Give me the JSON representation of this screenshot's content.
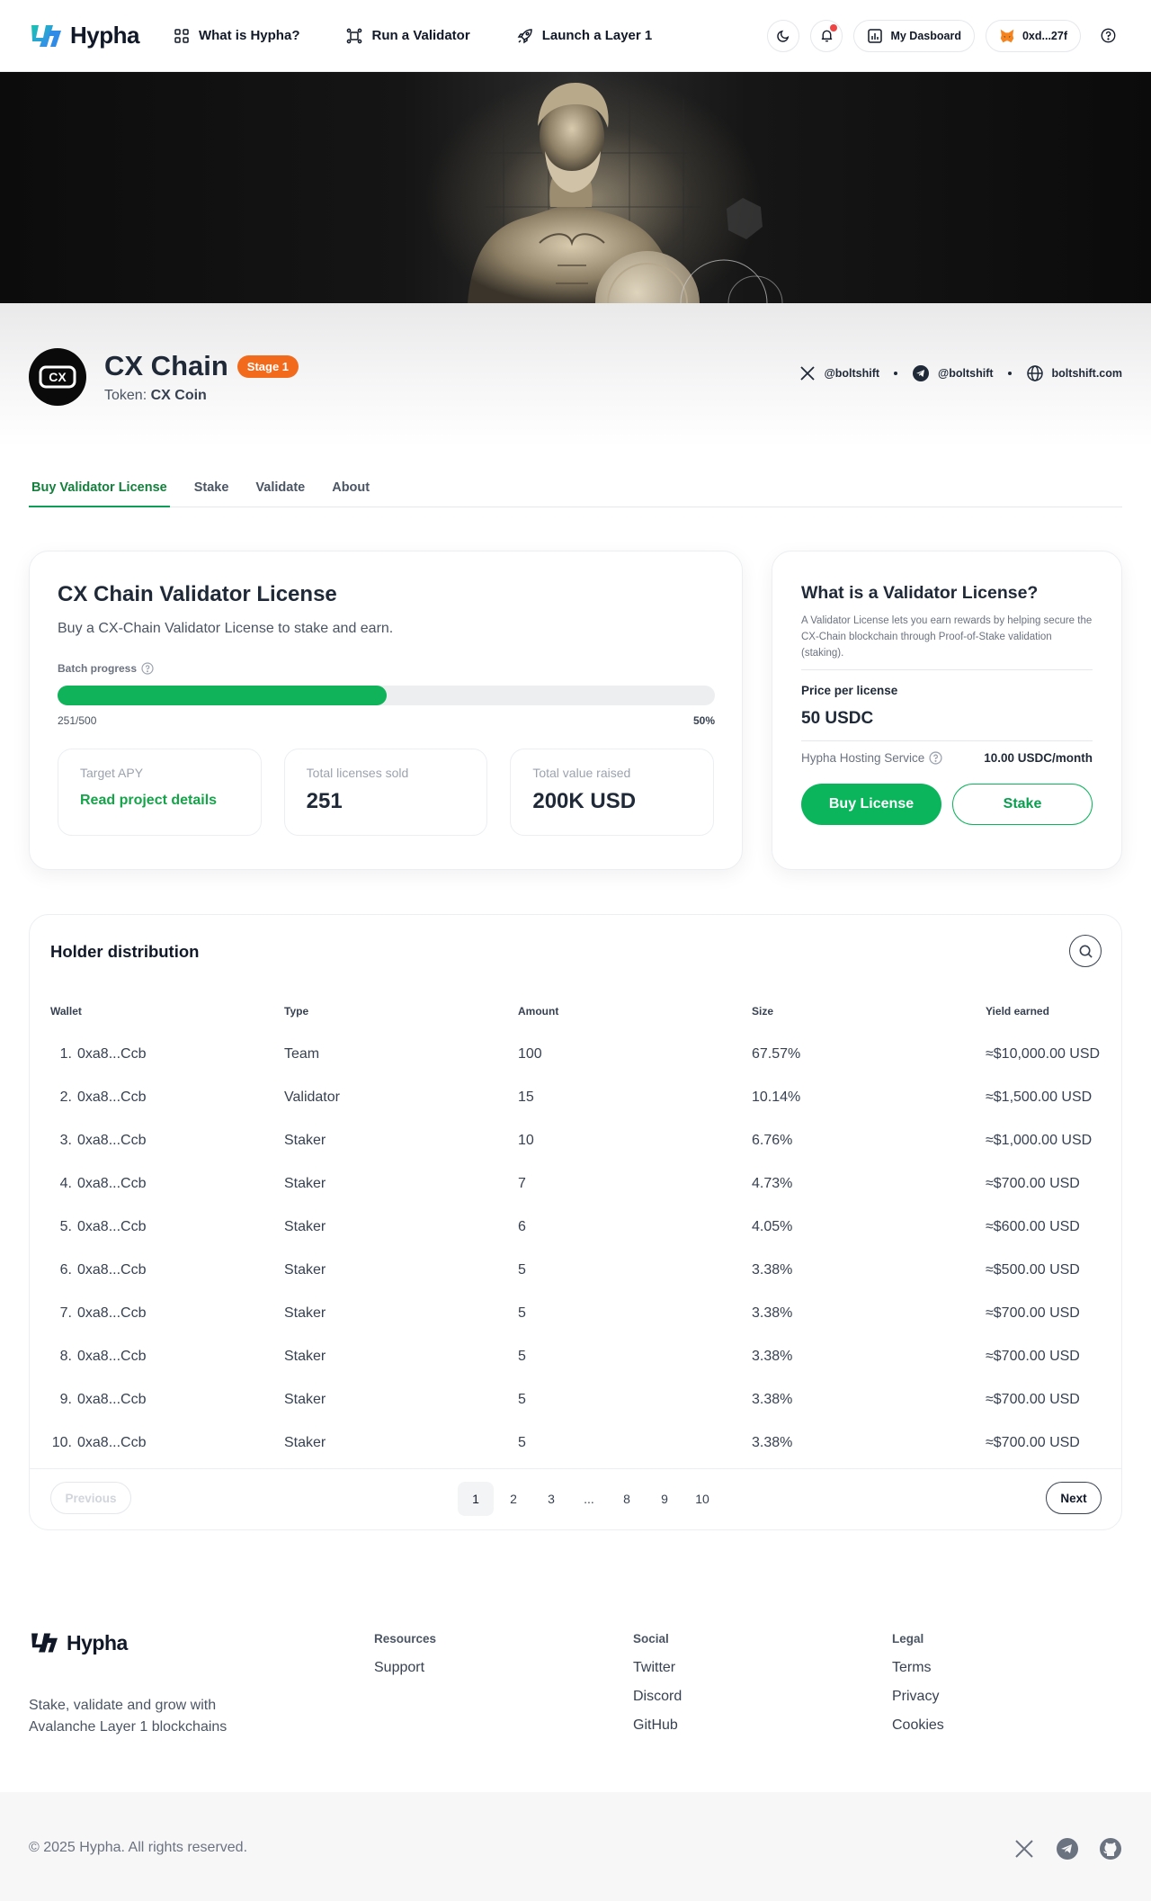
{
  "nav": {
    "brand": "Hypha",
    "links": [
      {
        "label": "What is Hypha?",
        "icon": "grid-icon"
      },
      {
        "label": "Run a Validator",
        "icon": "network-icon"
      },
      {
        "label": "Launch a Layer 1",
        "icon": "rocket-icon"
      }
    ],
    "dashboard_label": "My Dasboard",
    "wallet_label": "0xd...27f"
  },
  "project": {
    "name": "CX Chain",
    "stage": "Stage 1",
    "token_prefix": "Token:",
    "token": "CX Coin",
    "logo_text": "CX",
    "socials": {
      "x": "@boltshift",
      "telegram": "@boltshift",
      "website": "boltshift.com"
    }
  },
  "tabs": [
    "Buy Validator License",
    "Stake",
    "Validate",
    "About"
  ],
  "license": {
    "title": "CX Chain Validator License",
    "subtitle": "Buy a CX-Chain Validator License to stake and earn.",
    "batch_label": "Batch progress",
    "progress_text": "251/500",
    "progress_pct_text": "50%",
    "progress_fraction": 0.5,
    "stats": [
      {
        "label": "Target APY",
        "value": "Read project details"
      },
      {
        "label": "Total licenses sold",
        "value": "251"
      },
      {
        "label": "Total value raised",
        "value": "200K USD"
      }
    ]
  },
  "what": {
    "title": "What is a Validator License?",
    "description": "A Validator License lets you earn rewards by helping secure the CX-Chain blockchain through Proof-of-Stake validation (staking).",
    "price_label": "Price per license",
    "price": "50 USDC",
    "hosting_label": "Hypha Hosting Service",
    "hosting_value": "10.00 USDC/month",
    "buy_label": "Buy License",
    "stake_label": "Stake"
  },
  "holders": {
    "title": "Holder distribution",
    "columns": [
      "Wallet",
      "Type",
      "Amount",
      "Size",
      "Yield earned"
    ],
    "rows": [
      {
        "idx": "1.",
        "wallet": "0xa8...Ccb",
        "type": "Team",
        "amount": "100",
        "size": "67.57%",
        "yield": "≈$10,000.00 USD"
      },
      {
        "idx": "2.",
        "wallet": "0xa8...Ccb",
        "type": "Validator",
        "amount": "15",
        "size": "10.14%",
        "yield": "≈$1,500.00 USD"
      },
      {
        "idx": "3.",
        "wallet": "0xa8...Ccb",
        "type": "Staker",
        "amount": "10",
        "size": "6.76%",
        "yield": "≈$1,000.00 USD"
      },
      {
        "idx": "4.",
        "wallet": "0xa8...Ccb",
        "type": "Staker",
        "amount": "7",
        "size": "4.73%",
        "yield": "≈$700.00 USD"
      },
      {
        "idx": "5.",
        "wallet": "0xa8...Ccb",
        "type": "Staker",
        "amount": "6",
        "size": "4.05%",
        "yield": "≈$600.00 USD"
      },
      {
        "idx": "6.",
        "wallet": "0xa8...Ccb",
        "type": "Staker",
        "amount": "5",
        "size": "3.38%",
        "yield": "≈$500.00 USD"
      },
      {
        "idx": "7.",
        "wallet": "0xa8...Ccb",
        "type": "Staker",
        "amount": "5",
        "size": "3.38%",
        "yield": "≈$700.00 USD"
      },
      {
        "idx": "8.",
        "wallet": "0xa8...Ccb",
        "type": "Staker",
        "amount": "5",
        "size": "3.38%",
        "yield": "≈$700.00 USD"
      },
      {
        "idx": "9.",
        "wallet": "0xa8...Ccb",
        "type": "Staker",
        "amount": "5",
        "size": "3.38%",
        "yield": "≈$700.00 USD"
      },
      {
        "idx": "10.",
        "wallet": "0xa8...Ccb",
        "type": "Staker",
        "amount": "5",
        "size": "3.38%",
        "yield": "≈$700.00 USD"
      }
    ],
    "pagination": {
      "prev": "Previous",
      "next": "Next",
      "pages": [
        "1",
        "2",
        "3",
        "...",
        "8",
        "9",
        "10"
      ],
      "current": "1"
    }
  },
  "footer": {
    "brand": "Hypha",
    "tagline": "Stake, validate and grow with Avalanche Layer 1 blockchains",
    "columns": [
      {
        "title": "Resources",
        "links": [
          "Support"
        ]
      },
      {
        "title": "Social",
        "links": [
          "Twitter",
          "Discord",
          "GitHub"
        ]
      },
      {
        "title": "Legal",
        "links": [
          "Terms",
          "Privacy",
          "Cookies"
        ]
      }
    ],
    "copyright": "© 2025 Hypha. All rights reserved."
  },
  "colors": {
    "accent": "#0ab55b",
    "stage": "#f26b1d",
    "notification": "#ef4444"
  }
}
